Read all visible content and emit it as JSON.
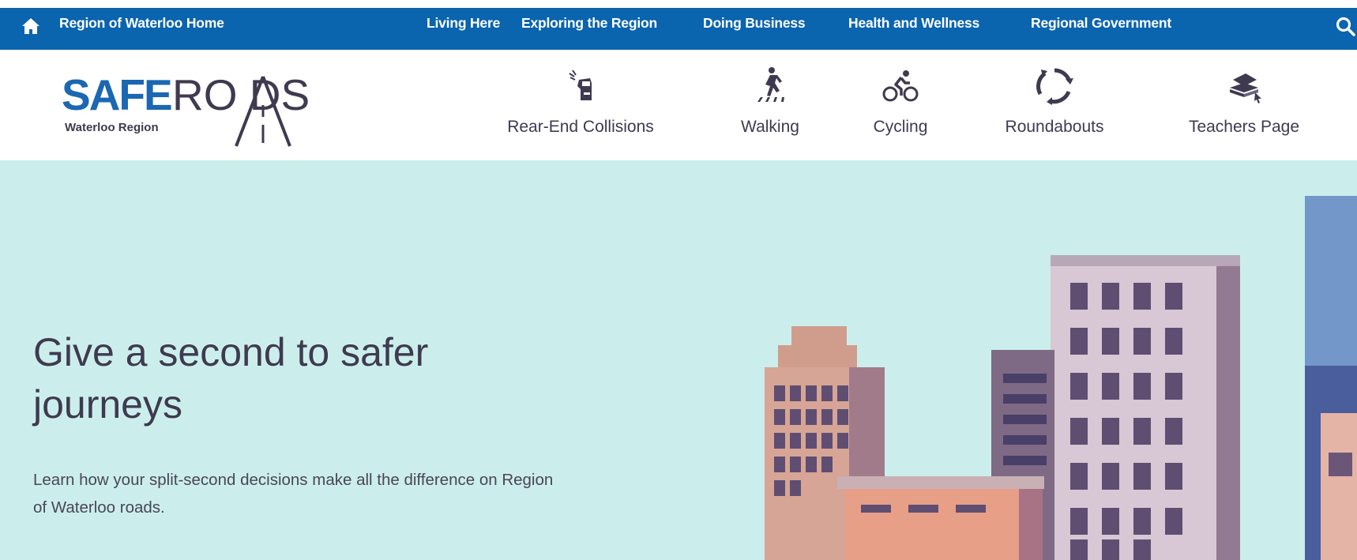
{
  "topnav": {
    "home_label": "Region of Waterloo Home",
    "links": [
      "Living Here",
      "Exploring the Region",
      "Doing Business",
      "Health and Wellness",
      "Regional Government"
    ],
    "home_icon": "home-icon",
    "search_icon": "search-icon"
  },
  "logo": {
    "safe": "SAFE",
    "roads": "RO  DS",
    "subtitle": "Waterloo Region"
  },
  "mainnav": {
    "items": [
      {
        "label": "Rear-End Collisions",
        "icon": "car-collision-icon"
      },
      {
        "label": "Walking",
        "icon": "pedestrian-icon"
      },
      {
        "label": "Cycling",
        "icon": "bicycle-icon"
      },
      {
        "label": "Roundabouts",
        "icon": "roundabout-icon"
      },
      {
        "label": "Teachers Page",
        "icon": "books-icon"
      }
    ]
  },
  "hero": {
    "title": "Give a second to safer journeys",
    "text": "Learn how your split-second decisions make all the difference on Region of Waterloo roads."
  },
  "colors": {
    "brand_blue": "#0a64ae",
    "hero_bg": "#cbeeec",
    "text_dark": "#3f3a4f"
  }
}
